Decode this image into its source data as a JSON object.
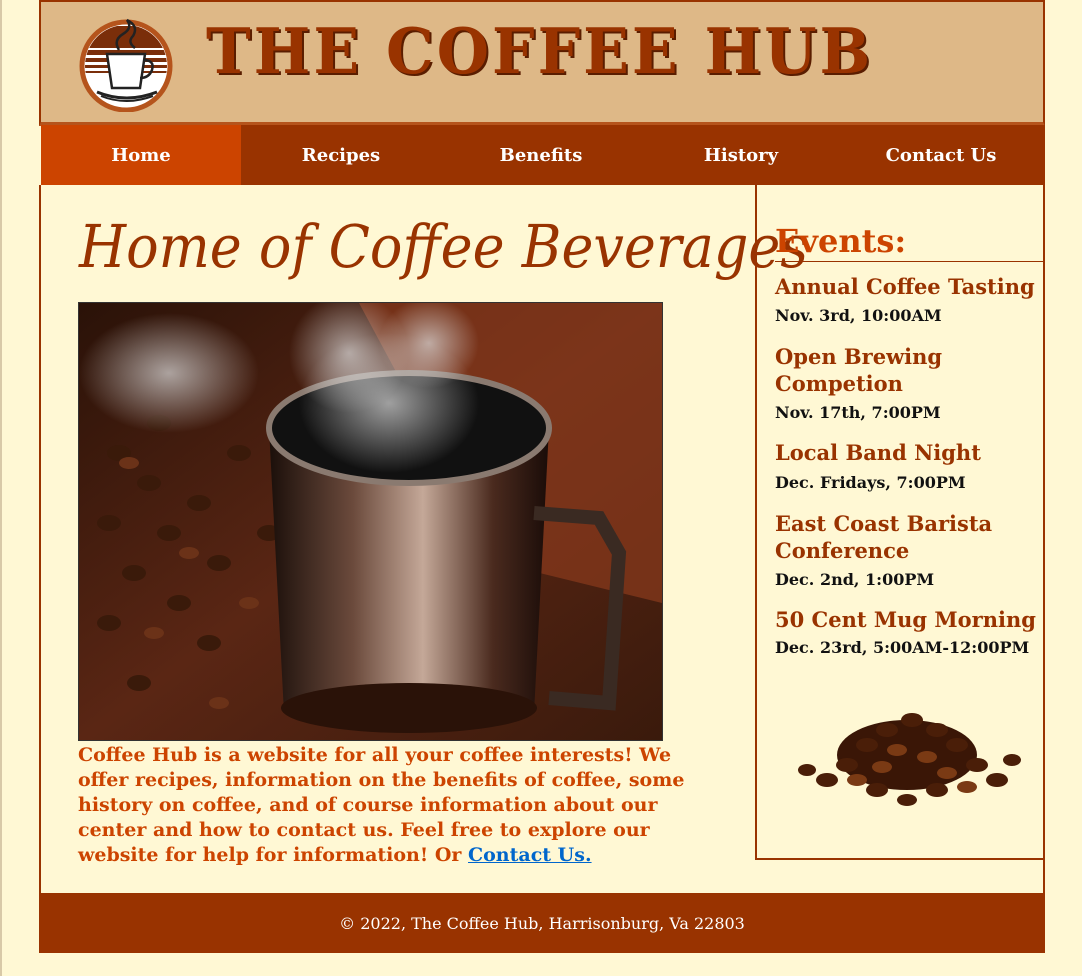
{
  "header": {
    "title": "THE COFFEE HUB",
    "logo_icon": "coffee-cup-logo-icon"
  },
  "nav": {
    "items": [
      {
        "label": "Home",
        "active": true
      },
      {
        "label": "Recipes",
        "active": false
      },
      {
        "label": "Benefits",
        "active": false
      },
      {
        "label": "History",
        "active": false
      },
      {
        "label": "Contact Us",
        "active": false
      }
    ]
  },
  "main": {
    "heading": "Home of Coffee Beverages",
    "intro_text": "Coffee Hub is a website for all your coffee interests! We offer recipes, information on the benefits of coffee, some history on coffee, and of course information about our center and how to contact us. Feel free to explore our website for help for information! Or ",
    "contact_link": "Contact Us."
  },
  "events": {
    "heading": "Events:",
    "items": [
      {
        "name": "Annual Coffee Tasting",
        "date": "Nov. 3rd, 10:00AM"
      },
      {
        "name": "Open Brewing Competion",
        "date": "Nov. 17th, 7:00PM"
      },
      {
        "name": "Local Band Night",
        "date": "Dec. Fridays, 7:00PM"
      },
      {
        "name": "East Coast Barista Conference",
        "date": "Dec. 2nd, 1:00PM"
      },
      {
        "name": "50 Cent Mug Morning",
        "date": "Dec. 23rd, 5:00AM-12:00PM"
      }
    ]
  },
  "footer": {
    "text": "© 2022, The Coffee Hub, Harrisonburg, Va 22803"
  },
  "colors": {
    "brand": "#993300",
    "accent": "#cc4400",
    "header_bg": "#deb887",
    "page_bg": "#fff8d4",
    "link": "#0066cc"
  }
}
